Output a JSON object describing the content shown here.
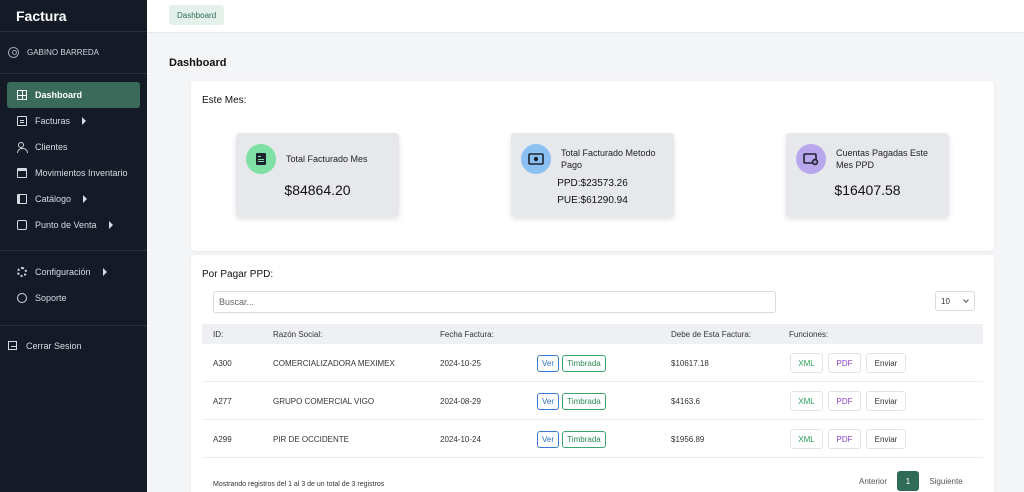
{
  "sidebar": {
    "brand": "Factura",
    "user": "GABINO BARREDA",
    "items": [
      {
        "label": "Dashboard"
      },
      {
        "label": "Facturas"
      },
      {
        "label": "Clientes"
      },
      {
        "label": "Movimientos Inventario"
      },
      {
        "label": "Catálogo"
      },
      {
        "label": "Punto de Venta"
      }
    ],
    "items2": [
      {
        "label": "Configuración"
      },
      {
        "label": "Soporte"
      }
    ],
    "logout": "Cerrar Sesion"
  },
  "topbar": {
    "breadcrumb": "Dashboard"
  },
  "main": {
    "title": "Dashboard",
    "this_month": {
      "label": "Este Mes:",
      "stats": [
        {
          "title": "Total Facturado Mes",
          "value": "$84864.20"
        },
        {
          "title": "Total Facturado Metodo Pago",
          "ppd": "PPD:$23573.26",
          "pue": "PUE:$61290.94"
        },
        {
          "title": "Cuentas Pagadas Este Mes PPD",
          "value": "$16407.58"
        }
      ]
    },
    "pending": {
      "label": "Por Pagar PPD:",
      "search_placeholder": "Buscar...",
      "page_size": "10",
      "headers": {
        "id": "ID:",
        "razon": "Razón Social:",
        "fecha": "Fecha Factura:",
        "debe": "Debe de Esta Factura:",
        "funciones": "Funciones:"
      },
      "rows": [
        {
          "id": "A300",
          "razon": "COMERCIALIZADORA MEXIMEX",
          "fecha": "2024-10-25",
          "debe": "$10617.18"
        },
        {
          "id": "A277",
          "razon": "GRUPO COMERCIAL VIGO",
          "fecha": "2024-08-29",
          "debe": "$4163.6"
        },
        {
          "id": "A299",
          "razon": "PIR DE OCCIDENTE",
          "fecha": "2024-10-24",
          "debe": "$1956.89"
        }
      ],
      "buttons": {
        "ver": "Ver",
        "timbrada": "Timbrada",
        "xml": "XML",
        "pdf": "PDF",
        "enviar": "Enviar"
      },
      "footer": "Mostrando registros del 1 al 3 de un total de 3 registros",
      "pager": {
        "prev": "Anterior",
        "page": "1",
        "next": "Siguiente"
      }
    }
  },
  "colors": {
    "sidebar_bg": "#151b26",
    "accent": "#3a6b5a",
    "stat_icon_green": "#7fe0a6",
    "stat_icon_blue": "#8cc0f2",
    "stat_icon_purple": "#b9a7ee"
  }
}
